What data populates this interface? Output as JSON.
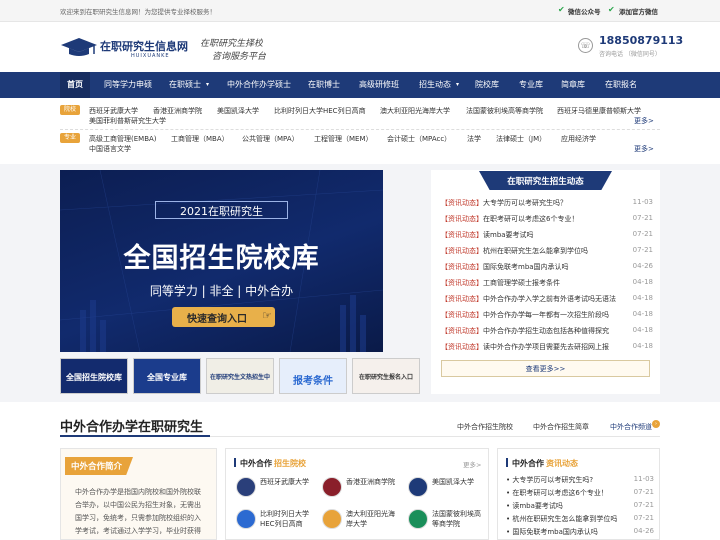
{
  "topbar": {
    "welcome": "欢迎来到在职研究生信息网！为您提供专业择校服务！",
    "wechat_public": "微信公众号",
    "add_official": "添加官方微信"
  },
  "header": {
    "logo_cn": "在职研究生信息网",
    "logo_en": "HUIXUANKE",
    "slogan_1": "在职研究生择校",
    "slogan_2": "咨询服务平台",
    "phone": "18850879113",
    "phone_note": "咨询电话 （微信同号）"
  },
  "nav": [
    {
      "label": "首页"
    },
    {
      "label": "同等学力申硕"
    },
    {
      "label": "在职硕士",
      "arrow": true
    },
    {
      "label": "中外合作办学硕士"
    },
    {
      "label": "在职博士"
    },
    {
      "label": "高级研修班"
    },
    {
      "label": "招生动态",
      "arrow": true
    },
    {
      "label": "院校库"
    },
    {
      "label": "专业库"
    },
    {
      "label": "简章库"
    },
    {
      "label": "在职报名"
    }
  ],
  "categories": {
    "schools_chip": "院校",
    "schools": [
      "西班牙武康大学",
      "香港亚洲商学院",
      "美国凯泽大学",
      "比利时列日大学HEC列日高商",
      "澳大利亚阳光海岸大学",
      "法国蒙彼利埃高等商学院",
      "西班牙马德里康普顿斯大学",
      "美国菲利普斯研究生大学"
    ],
    "majors_chip": "专业",
    "majors": [
      "高级工商管理(EMBA)",
      "工商管理（MBA）",
      "公共管理（MPA）",
      "工程管理（MEM）",
      "会计硕士（MPAcc）",
      "法学",
      "法律硕士（JM）",
      "应用经济学",
      "中国语言文学"
    ],
    "more": "更多>"
  },
  "banner": {
    "year_tag": "2021在职研究生",
    "title": "全国招生院校库",
    "subtitle": "同等学力 | 非全 | 中外合办",
    "button": "快速查询入口"
  },
  "thumbs": [
    {
      "label": "全国招生院校库",
      "bg": "#132b6e",
      "fg": "#ffffff"
    },
    {
      "label": "全国专业库",
      "bg": "#1b3c8c",
      "fg": "#ffffff"
    },
    {
      "label": "在职研究生文热招生中",
      "bg": "#f0eee6",
      "fg": "#1e3a78"
    },
    {
      "label": "报考条件",
      "bg": "#e6eefb",
      "fg": "#2c6ad1"
    },
    {
      "label": "在职研究生报名入口",
      "bg": "#f5f0ec",
      "fg": "#333333"
    }
  ],
  "news": {
    "title": "在职研究生招生动态",
    "items": [
      {
        "tag": "【资讯动态】",
        "text": "大专学历可以考研究生吗？",
        "date": "11-03"
      },
      {
        "tag": "【资讯动态】",
        "text": "在职考研可以考虑这6个专业！",
        "date": "07-21"
      },
      {
        "tag": "【资讯动态】",
        "text": "读mba要考试吗",
        "date": "07-21"
      },
      {
        "tag": "【资讯动态】",
        "text": "杭州在职研究生怎么能拿到学位吗",
        "date": "07-21"
      },
      {
        "tag": "【资讯动态】",
        "text": "国际免联考mba国内承认吗",
        "date": "04-26"
      },
      {
        "tag": "【资讯动态】",
        "text": "工商管理学硕士报考条件",
        "date": "04-18"
      },
      {
        "tag": "【资讯动态】",
        "text": "中外合作办学入学之前有外语考试吗无语法",
        "date": "04-18"
      },
      {
        "tag": "【资讯动态】",
        "text": "中外合作办学每一年都有一次招生阶段吗",
        "date": "04-18"
      },
      {
        "tag": "【资讯动态】",
        "text": "中外合作办学招生动态包括各种值得探究",
        "date": "04-18"
      },
      {
        "tag": "【资讯动态】",
        "text": "读中外合作办学项目需要先去研招网上报",
        "date": "04-18"
      }
    ],
    "more": "查看更多>>"
  },
  "zw": {
    "title": "中外合作办学在职研究生",
    "links": [
      "中外合作招生院校",
      "中外合作招生简章",
      "中外合作频道"
    ],
    "intro_title": "中外合作简介",
    "intro_text": "中外合作办学是指国内院校和国外院校联合举办，以中国公民为招生对象，无需出国学习，免统考，只需参加院校组织的入学考试，考试通过入学学习，毕业时获得国外硕士学位证书，可以在中国教育部留学服务中心进行认证。",
    "schools_title_1": "中外合作",
    "schools_title_2": "招生院校",
    "schools_more": "更多>",
    "schools": [
      {
        "name": "西班牙武康大学",
        "icon": "#2a3f7a"
      },
      {
        "name": "香港亚洲商学院",
        "icon": "#8a1f2a"
      },
      {
        "name": "美国凯泽大学",
        "icon": "#1e3a78"
      },
      {
        "name": "比利时列日大学HEC列日高商",
        "icon": "#2c6ad1"
      },
      {
        "name": "澳大利亚阳光海岸大学",
        "icon": "#e8a33a"
      },
      {
        "name": "法国蒙彼利埃高等商学院",
        "icon": "#1a8f5a"
      }
    ],
    "news_title_1": "中外合作",
    "news_title_2": "资讯动态",
    "news_items": [
      {
        "text": "大专学历可以考研究生吗?",
        "date": "11-03"
      },
      {
        "text": "在职考研可以考虑这6个专业！",
        "date": "07-21"
      },
      {
        "text": "读mba要考试吗",
        "date": "07-21"
      },
      {
        "text": "杭州在职研究生怎么能拿到学位吗",
        "date": "07-21"
      },
      {
        "text": "国际免联考mba国内承认吗",
        "date": "04-26"
      }
    ]
  },
  "colors": {
    "brand": "#1e3a78",
    "accent": "#e8a33a",
    "news_tag": "#c0392b"
  }
}
